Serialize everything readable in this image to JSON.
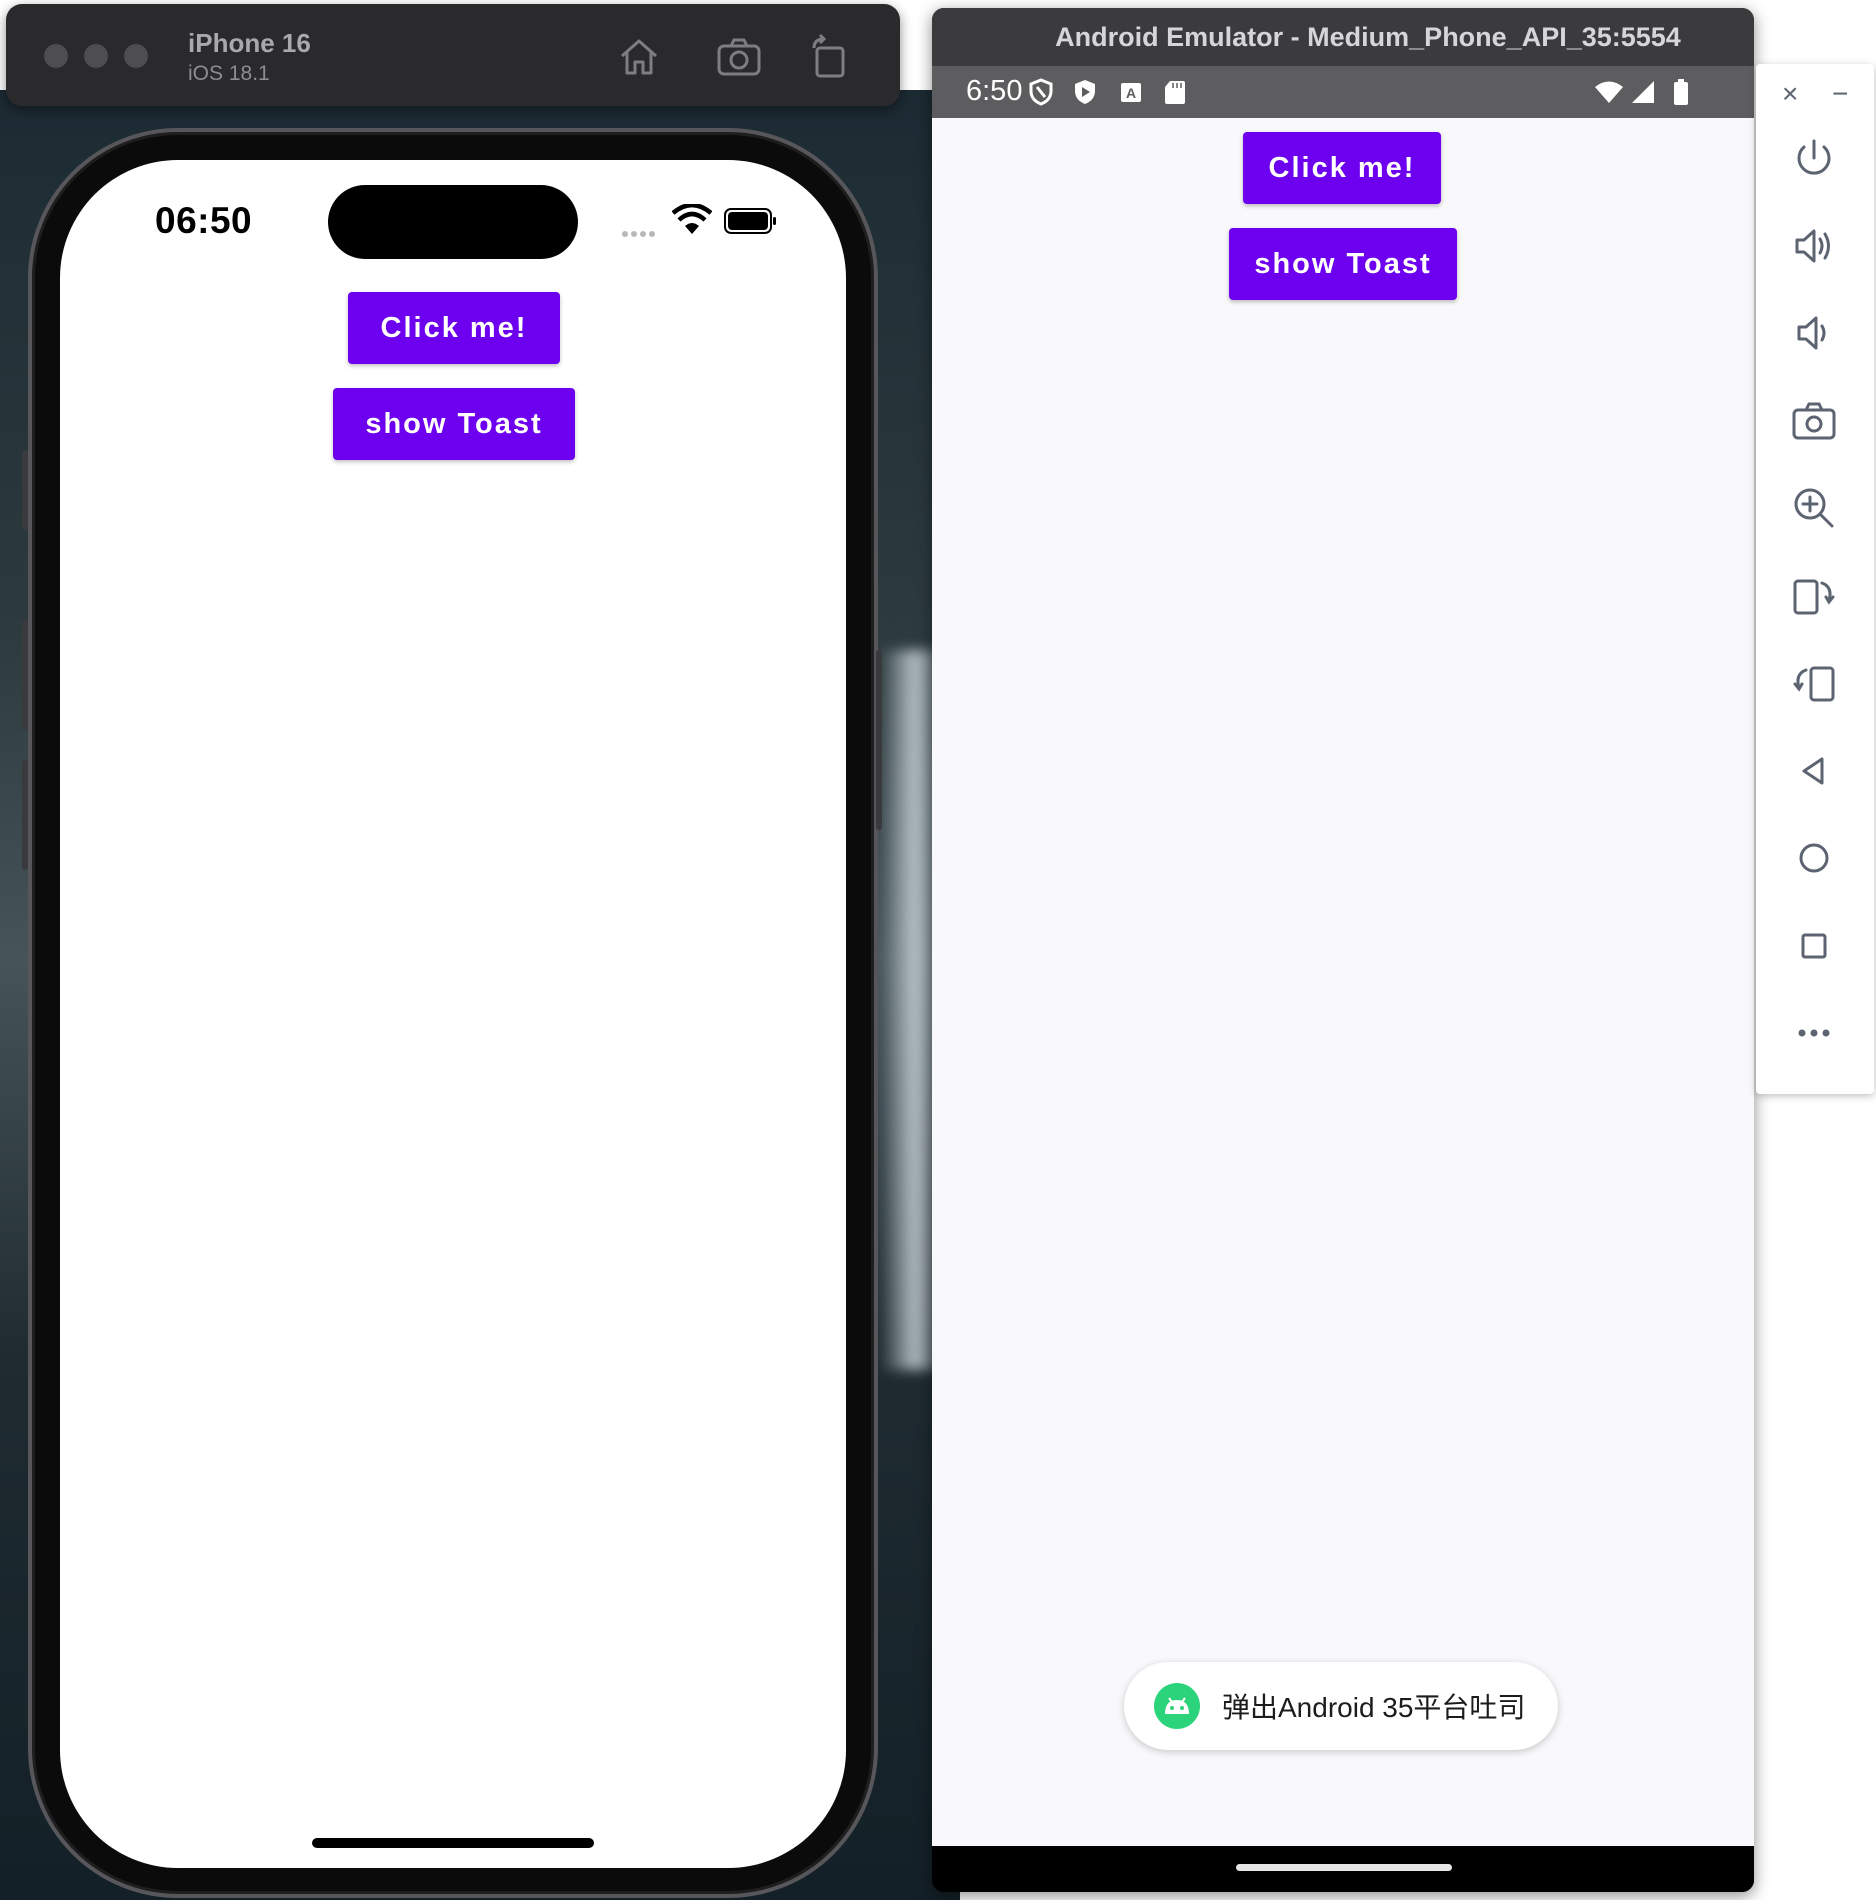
{
  "ios_simulator": {
    "device_name": "iPhone 16",
    "os_version": "iOS 18.1",
    "toolbar_icons": [
      "home-icon",
      "screenshot-icon",
      "rotate-icon"
    ],
    "status_time": "06:50",
    "buttons": {
      "click_me": "Click me!",
      "show_toast": "show Toast"
    }
  },
  "android_emulator": {
    "window_title": "Android Emulator - Medium_Phone_API_35:5554",
    "status_time": "6:50",
    "buttons": {
      "click_me": "Click me!",
      "show_toast": "show Toast"
    },
    "toast_message": "弹出Android 35平台吐司"
  },
  "emulator_controls": {
    "close": "×",
    "minimize": "−",
    "items": [
      "power-icon",
      "volume-up-icon",
      "volume-down-icon",
      "camera-icon",
      "zoom-icon",
      "rotate-left-icon",
      "rotate-right-icon",
      "back-icon",
      "home-icon",
      "overview-icon",
      "more-icon"
    ]
  },
  "colors": {
    "button": "#6d00ee",
    "toast_icon": "#2bd47a",
    "panel_icon": "#5b6470"
  }
}
